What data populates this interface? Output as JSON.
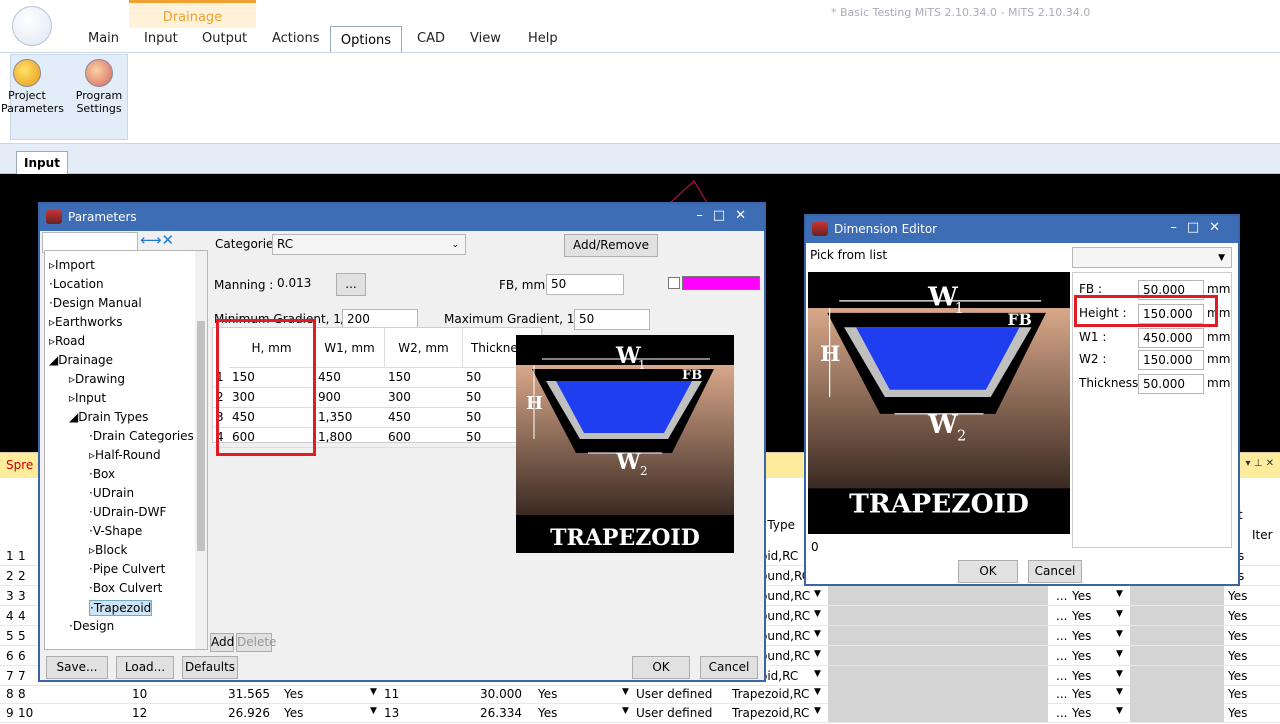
{
  "app": {
    "title": "* Basic Testing MiTS 2.10.34.0 - MiTS 2.10.34.0",
    "tab_main": "Main",
    "group_drainage": "Drainage",
    "tab_input": "Input",
    "tab_output": "Output",
    "tab_actions": "Actions",
    "tab_options": "Options",
    "tab_cad": "CAD",
    "tab_view": "View",
    "tab_help": "Help",
    "btn_project_l1": "Project",
    "btn_project_l2": "Parameters",
    "btn_program_l1": "Program",
    "btn_program_l2": "Settings",
    "doc_tab": "Input",
    "spread_title": "Spre"
  },
  "parameters_dialog": {
    "title": "Parameters",
    "tree_items": [
      "Import",
      "Location",
      "Design Manual",
      "Earthworks",
      "Road",
      "Drainage",
      "Drawing",
      "Input",
      "Drain Types",
      "Drain Categories",
      "Half-Round",
      "Box",
      "UDrain",
      "UDrain-DWF",
      "V-Shape",
      "Block",
      "Pipe Culvert",
      "Box Culvert",
      "Trapezoid",
      "Design"
    ],
    "categories_label": "Categories",
    "categories_value": "RC",
    "add_remove": "Add/Remove",
    "manning_label": "Manning :",
    "manning_value": "0.013",
    "ellipsis": "...",
    "fb_label": "FB, mm :",
    "fb_value": "50",
    "min_grad_label": "Minimum Gradient, 1/x :",
    "min_grad_value": "200",
    "max_grad_label": "Maximum Gradient, 1/x :",
    "max_grad_value": "50",
    "table_headers": [
      "H, mm",
      "W1, mm",
      "W2, mm",
      "Thickness,"
    ],
    "table_rows": [
      {
        "n": "1",
        "h": "150",
        "w1": "450",
        "w2": "150",
        "t": "50"
      },
      {
        "n": "2",
        "h": "300",
        "w1": "900",
        "w2": "300",
        "t": "50"
      },
      {
        "n": "3",
        "h": "450",
        "w1": "1,350",
        "w2": "450",
        "t": "50"
      },
      {
        "n": "4",
        "h": "600",
        "w1": "1,800",
        "w2": "600",
        "t": "50"
      }
    ],
    "add": "Add",
    "delete": "Delete",
    "save": "Save...",
    "load": "Load...",
    "defaults": "Defaults",
    "ok": "OK",
    "cancel": "Cancel",
    "swatch_color": "#ff00ff"
  },
  "dimension_editor": {
    "title": "Dimension Editor",
    "pick_label": "Pick from list",
    "fb_label": "FB :",
    "fb_value": "50.000",
    "height_label": "Height :",
    "height_value": "150.000",
    "w1_label": "W1 :",
    "w1_value": "450.000",
    "w2_label": "W2 :",
    "w2_value": "150.000",
    "thickness_label": "Thickness :",
    "thickness_value": "50.000",
    "unit": "mm",
    "status": "0",
    "ok": "OK",
    "cancel": "Cancel"
  },
  "diagram": {
    "w1": "W",
    "w1_sub": "1",
    "w2": "W",
    "w2_sub": "2",
    "h": "H",
    "fb": "FB",
    "caption": "TRAPEZOID"
  },
  "grid": {
    "col_header_drain_type": "n Type",
    "col_header_it": "t",
    "col_header_iter": "Iter",
    "rows": [
      {
        "n": "1",
        "a": "1",
        "type": "oid,RC",
        "yes2": "s"
      },
      {
        "n": "2",
        "a": "2",
        "type": "ound,RC",
        "yes2": "s"
      },
      {
        "n": "3",
        "a": "3",
        "type": "ound,RC",
        "yes1": "Yes",
        "yes2": "Yes"
      },
      {
        "n": "4",
        "a": "4",
        "type": "ound,RC",
        "yes1": "Yes",
        "yes2": "Yes"
      },
      {
        "n": "5",
        "a": "5",
        "type": "ound,RC",
        "yes1": "Yes",
        "yes2": "Yes"
      },
      {
        "n": "6",
        "a": "6",
        "type": "ound,RC",
        "yes1": "Yes",
        "yes2": "Yes"
      },
      {
        "n": "7",
        "a": "7",
        "type": "oid,RC",
        "yes1": "Yes",
        "yes2": "Yes"
      },
      {
        "n": "8",
        "a": "8",
        "b": "10",
        "c": "31.565",
        "d": "Yes",
        "e": "11",
        "f": "30.000",
        "g": "Yes",
        "h": "User defined",
        "type": "Trapezoid,RC",
        "yes1": "Yes",
        "yes2": "Yes"
      },
      {
        "n": "9",
        "a": "10",
        "b": "12",
        "c": "26.926",
        "d": "Yes",
        "e": "13",
        "f": "26.334",
        "g": "Yes",
        "h": "User defined",
        "type": "Trapezoid,RC",
        "yes1": "Yes",
        "yes2": "Yes"
      }
    ]
  }
}
